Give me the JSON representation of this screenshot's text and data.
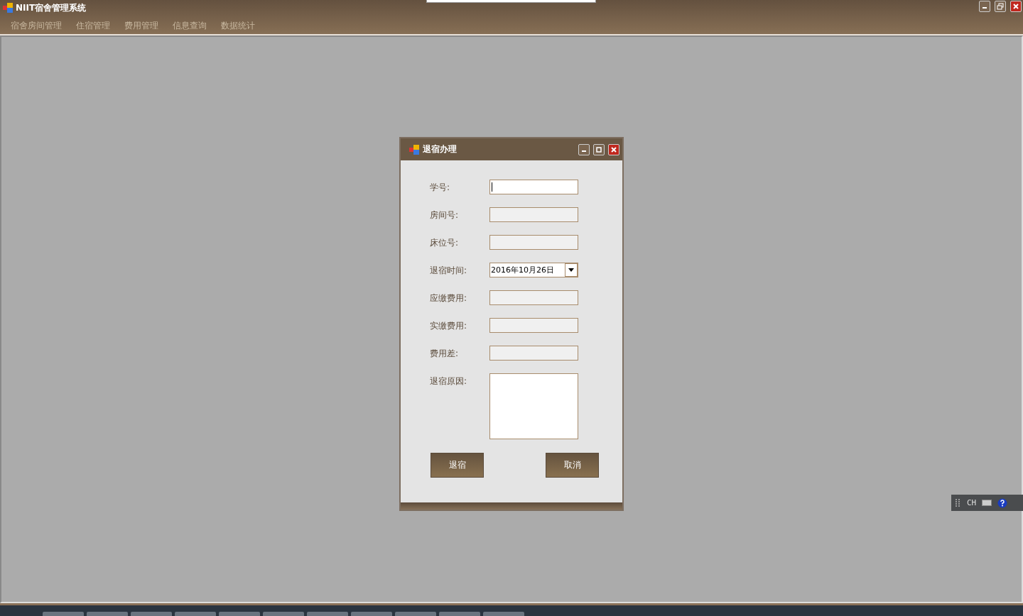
{
  "window": {
    "title": "NIIT宿舍管理系统"
  },
  "menu": [
    {
      "label": "宿舍房间管理"
    },
    {
      "label": "住宿管理"
    },
    {
      "label": "费用管理"
    },
    {
      "label": "信息查询"
    },
    {
      "label": "数据统计"
    }
  ],
  "dialog": {
    "title": "退宿办理",
    "fields": [
      {
        "label": "学号:",
        "kind": "text",
        "disabled": false,
        "focused": true
      },
      {
        "label": "房间号:",
        "kind": "text",
        "disabled": true,
        "focused": false
      },
      {
        "label": "床位号:",
        "kind": "text",
        "disabled": true,
        "focused": false
      },
      {
        "label": "退宿时间:",
        "kind": "date",
        "value": "2016年10月26日"
      },
      {
        "label": "应缴费用:",
        "kind": "text",
        "disabled": true,
        "focused": false
      },
      {
        "label": "实缴费用:",
        "kind": "text",
        "disabled": true,
        "focused": false
      },
      {
        "label": "费用差:",
        "kind": "text",
        "disabled": true,
        "focused": false
      },
      {
        "label": "退宿原因:",
        "kind": "textarea"
      }
    ],
    "buttons": [
      {
        "label": "退宿"
      },
      {
        "label": "取消"
      }
    ]
  },
  "ime_bar": {
    "language": "CH"
  }
}
